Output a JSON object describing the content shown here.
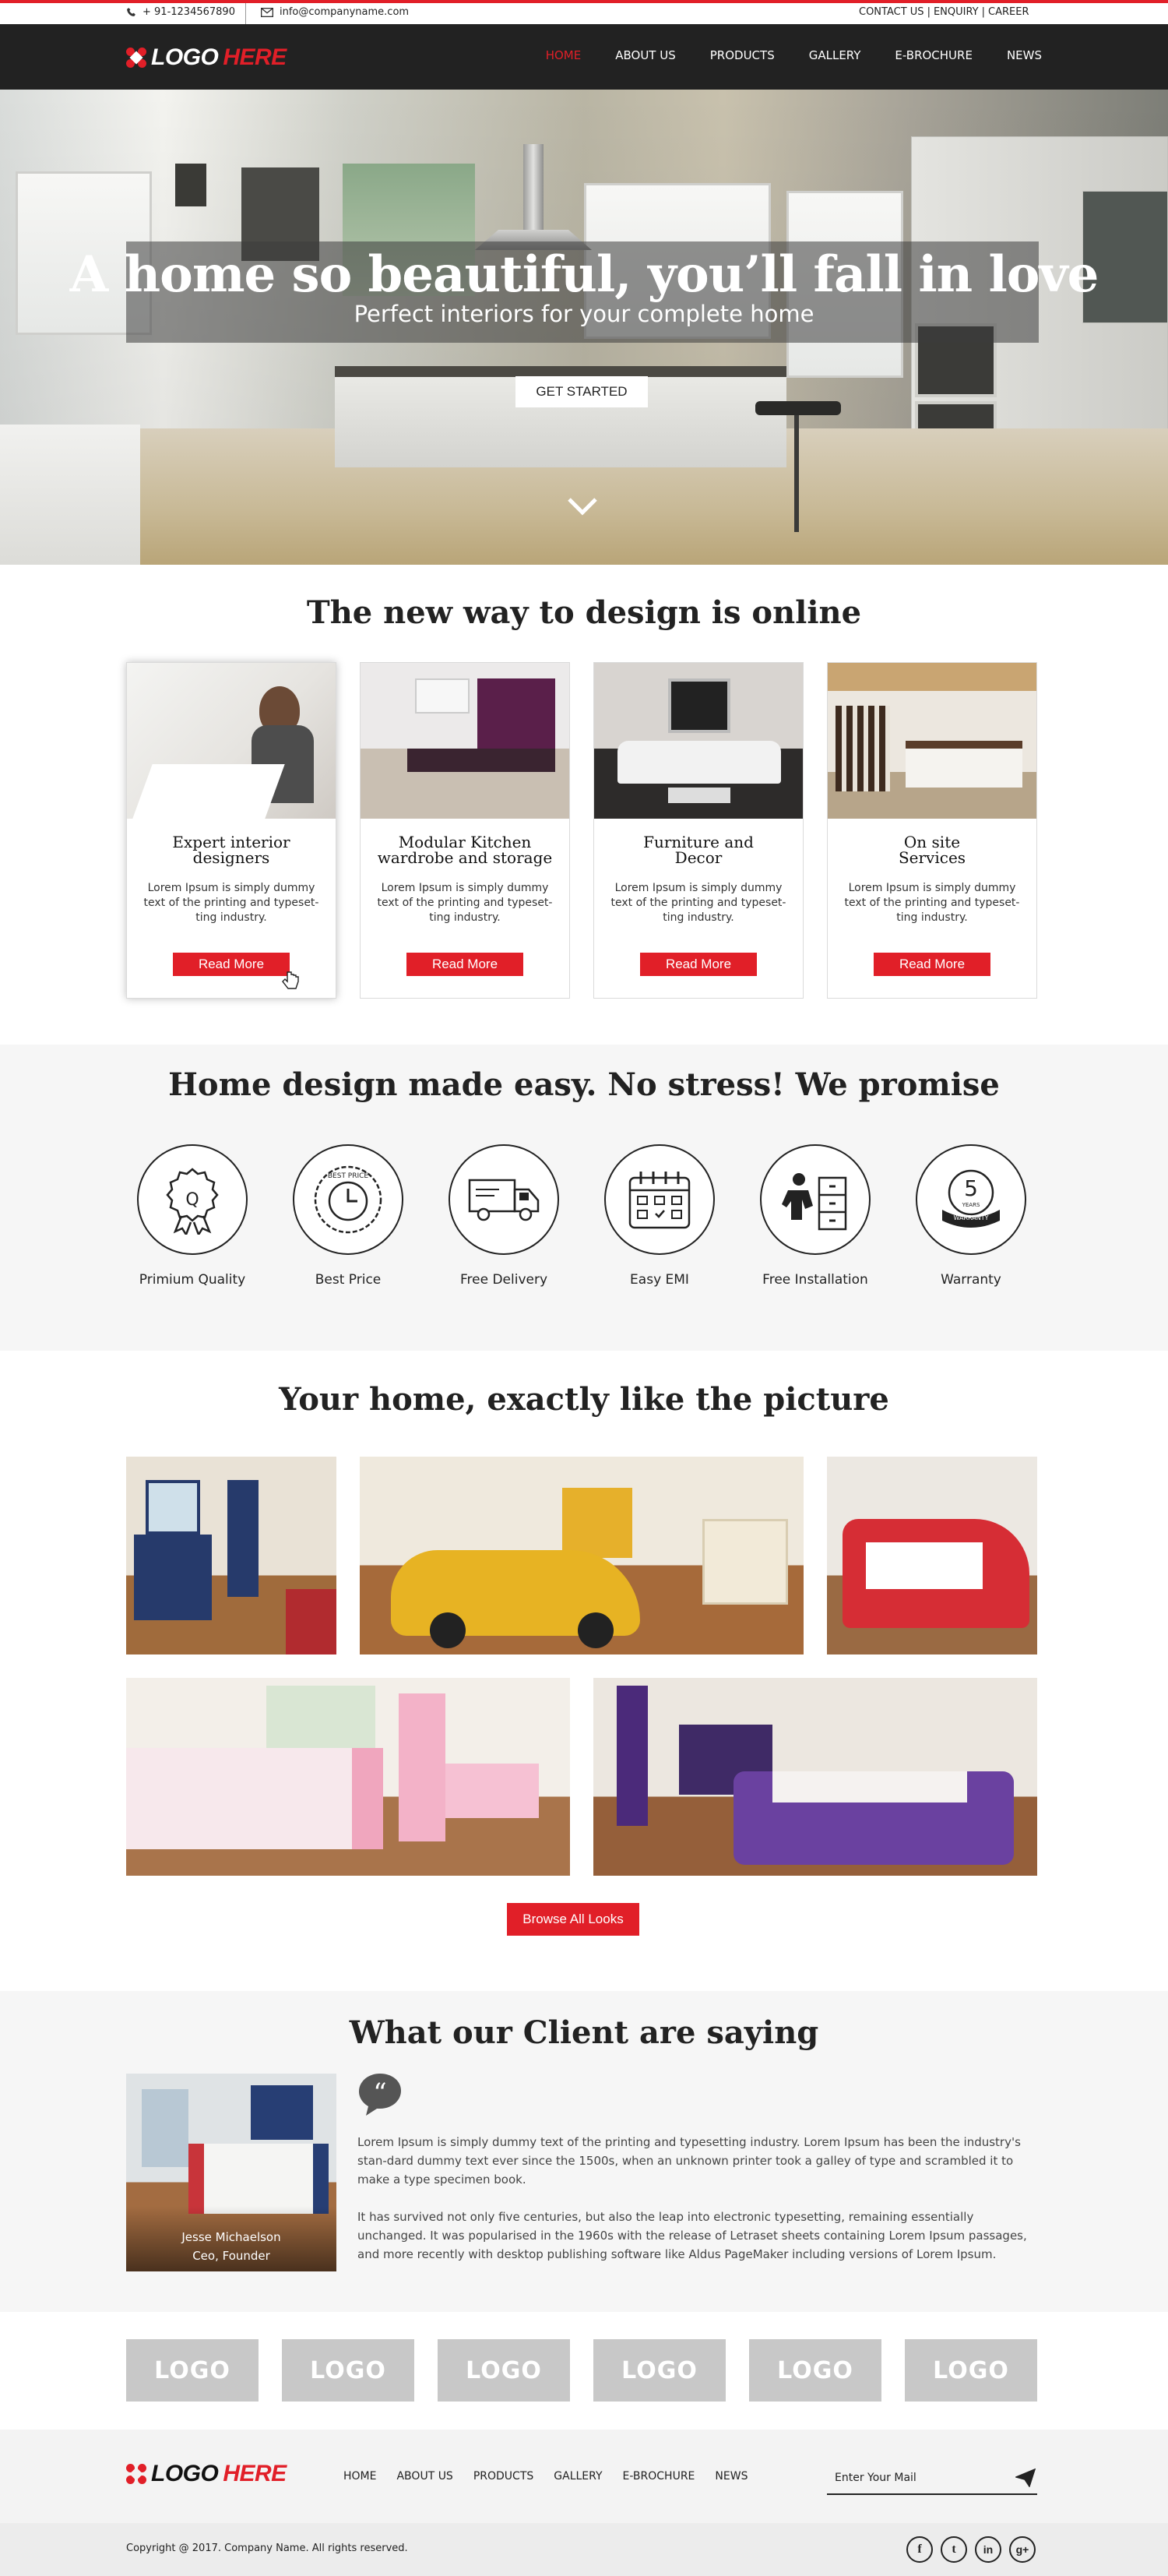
{
  "topbar": {
    "phone": "+ 91-1234567890",
    "email": "info@companyname.com",
    "links": [
      "CONTACT US",
      "ENQUIRY",
      "CAREER"
    ]
  },
  "logo": {
    "part1": "LOGO",
    "part2": "HERE"
  },
  "nav": {
    "items": [
      "HOME",
      "ABOUT US",
      "PRODUCTS",
      "GALLERY",
      "E-BROCHURE",
      "NEWS"
    ],
    "active": "HOME"
  },
  "hero": {
    "title": "A home so beautiful, you’ll fall in love",
    "subtitle": "Perfect interiors for your complete home",
    "cta": "GET STARTED"
  },
  "design": {
    "title": "The new way to design is online",
    "cards": [
      {
        "title_line1": "Expert interior",
        "title_line2": "designers",
        "desc": "Lorem Ipsum is simply dummy text of the printing and typeset-ting industry.",
        "button": "Read More"
      },
      {
        "title_line1": "Modular Kitchen",
        "title_line2": "wardrobe and storage",
        "desc": "Lorem Ipsum is simply dummy text of the printing and typeset-ting industry.",
        "button": "Read More"
      },
      {
        "title_line1": "Furniture and",
        "title_line2": "Decor",
        "desc": "Lorem Ipsum is simply dummy text of the printing and typeset-ting industry.",
        "button": "Read More"
      },
      {
        "title_line1": "On site",
        "title_line2": "Services",
        "desc": "Lorem Ipsum is simply dummy text of the printing and typeset-ting industry.",
        "button": "Read More"
      }
    ]
  },
  "promise": {
    "title": "Home design made easy. No stress! We promise",
    "features": [
      {
        "label": "Primium Quality",
        "icon": "quality-badge-icon"
      },
      {
        "label": "Best Price",
        "icon": "best-price-icon"
      },
      {
        "label": "Free Delivery",
        "icon": "delivery-truck-icon"
      },
      {
        "label": "Easy EMI",
        "icon": "calendar-icon"
      },
      {
        "label": "Free Installation",
        "icon": "installation-icon"
      },
      {
        "label": "Warranty",
        "icon": "warranty-icon"
      }
    ],
    "warranty_badge": {
      "number": "5",
      "years": "YEARS",
      "word": "WARRANTY"
    },
    "price_badge": {
      "top": "BEST PRICE"
    }
  },
  "gallery": {
    "title": "Your home, exactly like the picture",
    "browse": "Browse All Looks"
  },
  "testimonials": {
    "title": "What our Client are saying",
    "name": "Jesse Michaelson",
    "role": "Ceo, Founder",
    "para1": "Lorem Ipsum is simply dummy text of the printing and typesetting industry. Lorem Ipsum has been the industry's stan-dard dummy text ever since the 1500s, when an unknown printer took a galley of type and scrambled it to make a type specimen book.",
    "para2": "It has survived not only five centuries, but also the leap into electronic typesetting, remaining essentially unchanged. It was popularised in the 1960s with the release of Letraset sheets containing Lorem Ipsum passages, and more recently with desktop publishing software like Aldus PageMaker including versions of Lorem Ipsum."
  },
  "brands": [
    "LOGO",
    "LOGO",
    "LOGO",
    "LOGO",
    "LOGO",
    "LOGO"
  ],
  "footer": {
    "menu": [
      "HOME",
      "ABOUT US",
      "PRODUCTS",
      "GALLERY",
      "E-BROCHURE",
      "NEWS"
    ],
    "mail_placeholder": "Enter Your Mail",
    "copyright": "Copyright @ 2017.  Company Name.  All rights reserved.",
    "social": [
      "f",
      "t",
      "in",
      "g+"
    ]
  },
  "colors": {
    "accent": "#e11f28",
    "nav_bg": "#222222",
    "light_bg": "#f6f6f6",
    "logo_gray": "#c8c8c8"
  }
}
